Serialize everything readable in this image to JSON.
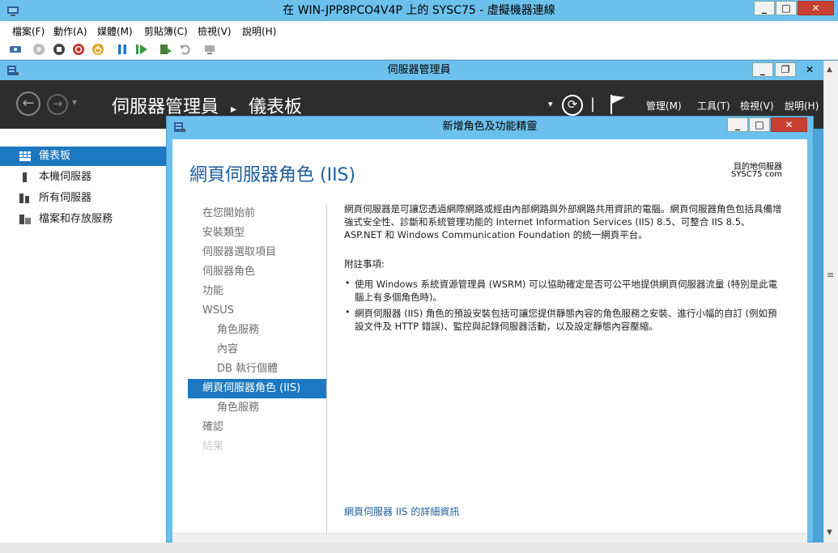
{
  "vm_window": {
    "title": "在 WIN-JPP8PCO4V4P 上的 SYSC75 - 虛擬機器連線",
    "menu": [
      "檔案(F)",
      "動作(A)",
      "媒體(M)",
      "剪貼簿(C)",
      "檢視(V)",
      "說明(H)"
    ],
    "controls": {
      "minimize": "_",
      "maximize": "□",
      "close": "✕"
    }
  },
  "server_manager": {
    "title": "伺服器管理員",
    "breadcrumb": {
      "root": "伺服器管理員",
      "separator": "▸",
      "current": "儀表板"
    },
    "nav": {
      "back": "←",
      "forward": "→",
      "dropdown": "▾",
      "refresh": "⟳",
      "pipe": "|"
    },
    "menu": [
      "管理(M)",
      "工具(T)",
      "檢視(V)",
      "說明(H)"
    ],
    "controls": {
      "minimize": "_",
      "maximize": "❐",
      "close": "✕"
    },
    "sidebar": [
      {
        "label": "儀表板",
        "active": true
      },
      {
        "label": "本機伺服器",
        "active": false
      },
      {
        "label": "所有伺服器",
        "active": false
      },
      {
        "label": "檔案和存放服務",
        "active": false
      }
    ],
    "scroll_thumb": "≡"
  },
  "wizard": {
    "title": "新增角色及功能精靈",
    "controls": {
      "minimize": "_",
      "maximize": "□",
      "close": "✕"
    },
    "heading": "網頁伺服器角色 (IIS)",
    "destination_label": "目的地伺服器",
    "destination_value": "SYSC75           com",
    "steps": [
      {
        "label": "在您開始前",
        "level": 0,
        "state": "normal"
      },
      {
        "label": "安裝類型",
        "level": 0,
        "state": "normal"
      },
      {
        "label": "伺服器選取項目",
        "level": 0,
        "state": "normal"
      },
      {
        "label": "伺服器角色",
        "level": 0,
        "state": "normal"
      },
      {
        "label": "功能",
        "level": 0,
        "state": "normal"
      },
      {
        "label": "WSUS",
        "level": 0,
        "state": "normal"
      },
      {
        "label": "角色服務",
        "level": 1,
        "state": "normal"
      },
      {
        "label": "內容",
        "level": 1,
        "state": "normal"
      },
      {
        "label": "DB 執行個體",
        "level": 1,
        "state": "normal"
      },
      {
        "label": "網頁伺服器角色 (IIS)",
        "level": 0,
        "state": "active"
      },
      {
        "label": "角色服務",
        "level": 1,
        "state": "normal"
      },
      {
        "label": "確認",
        "level": 0,
        "state": "normal"
      },
      {
        "label": "結果",
        "level": 0,
        "state": "disabled"
      }
    ],
    "description": "網頁伺服器是可讓您透過網際網路或經由內部網路與外部網路共用資訊的電腦。網頁伺服器角色包括具備增強式安全性、診斷和系統管理功能的 Internet Information Services (IIS) 8.5、可整合 IIS 8.5、ASP.NET 和 Windows Communication Foundation 的統一網頁平台。",
    "notes_title": "附註事項:",
    "notes": [
      "使用 Windows 系統資源管理員 (WSRM) 可以協助確定是否可公平地提供網頁伺服器流量 (特別是此電腦上有多個角色時)。",
      "網頁伺服器 (IIS) 角色的預設安裝包括可讓您提供靜態內容的角色服務之安裝、進行小幅的自訂 (例如預設文件及 HTTP 錯誤)、監控與記錄伺服器活動，以及設定靜態內容壓縮。"
    ],
    "link": "網頁伺服器 IIS 的詳細資訊"
  },
  "colors": {
    "titlebar": "#6cc0ec",
    "accent": "#1c78c0",
    "header_dark": "#2d2d2d",
    "close_red": "#c84031"
  }
}
